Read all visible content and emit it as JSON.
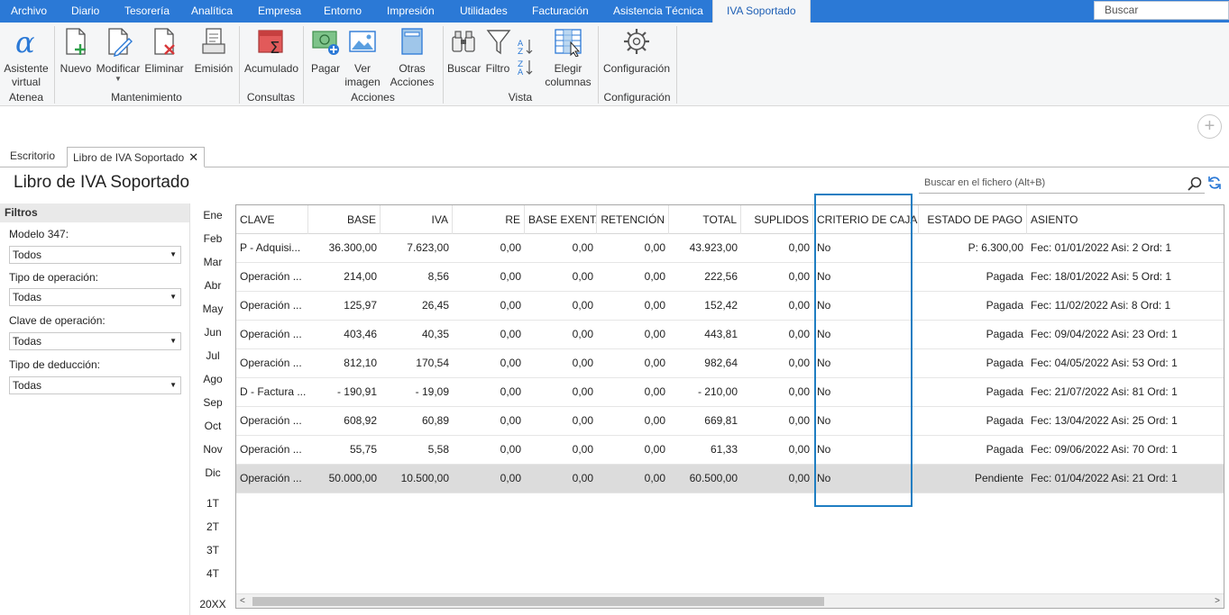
{
  "menu": {
    "items": [
      "Archivo",
      "Diario",
      "Tesorería",
      "Analítica",
      "Empresa",
      "Entorno",
      "Impresión",
      "Utilidades",
      "Facturación",
      "Asistencia Técnica",
      "IVA Soportado"
    ],
    "search_placeholder": "Buscar"
  },
  "ribbon": {
    "asistente": "Asistente virtual",
    "nuevo": "Nuevo",
    "modificar": "Modificar",
    "eliminar": "Eliminar",
    "emision": "Emisión",
    "acumulado": "Acumulado",
    "pagar": "Pagar",
    "ver_imagen": "Ver imagen",
    "otras_acciones": "Otras Acciones",
    "buscar": "Buscar",
    "filtro": "Filtro",
    "elegir_columnas": "Elegir columnas",
    "configuracion": "Configuración",
    "groups": {
      "atenea": "Atenea",
      "mantenimiento": "Mantenimiento",
      "consultas": "Consultas",
      "acciones": "Acciones",
      "vista": "Vista",
      "configuracion": "Configuración"
    }
  },
  "tabs": [
    "Escritorio",
    "Libro de IVA Soportado"
  ],
  "page_title": "Libro de IVA Soportado",
  "file_search_placeholder": "Buscar en el fichero (Alt+B)",
  "filters": {
    "title": "Filtros",
    "modelo_label": "Modelo 347:",
    "modelo_value": "Todos",
    "tipo_op_label": "Tipo de operación:",
    "tipo_op_value": "Todas",
    "clave_label": "Clave de operación:",
    "clave_value": "Todas",
    "deduccion_label": "Tipo de deducción:",
    "deduccion_value": "Todas"
  },
  "periods": {
    "months": [
      "Ene",
      "Feb",
      "Mar",
      "Abr",
      "May",
      "Jun",
      "Jul",
      "Ago",
      "Sep",
      "Oct",
      "Nov",
      "Dic"
    ],
    "quarters": [
      "1T",
      "2T",
      "3T",
      "4T"
    ],
    "year": "20XX"
  },
  "table": {
    "headers": [
      "CLAVE",
      "BASE",
      "IVA",
      "RE",
      "BASE EXENTA",
      "RETENCIÓN",
      "TOTAL",
      "SUPLIDOS",
      "CRITERIO DE CAJA",
      "ESTADO DE PAGO",
      "ASIENTO"
    ],
    "rows": [
      [
        "P - Adquisi...",
        "36.300,00",
        "7.623,00",
        "0,00",
        "0,00",
        "0,00",
        "43.923,00",
        "0,00",
        "No",
        "P: 6.300,00",
        "Fec: 01/01/2022 Asi: 2 Ord: 1"
      ],
      [
        "Operación ...",
        "214,00",
        "8,56",
        "0,00",
        "0,00",
        "0,00",
        "222,56",
        "0,00",
        "No",
        "Pagada",
        "Fec: 18/01/2022 Asi: 5 Ord: 1"
      ],
      [
        "Operación ...",
        "125,97",
        "26,45",
        "0,00",
        "0,00",
        "0,00",
        "152,42",
        "0,00",
        "No",
        "Pagada",
        "Fec: 11/02/2022 Asi: 8 Ord: 1"
      ],
      [
        "Operación ...",
        "403,46",
        "40,35",
        "0,00",
        "0,00",
        "0,00",
        "443,81",
        "0,00",
        "No",
        "Pagada",
        "Fec: 09/04/2022 Asi: 23 Ord: 1"
      ],
      [
        "Operación ...",
        "812,10",
        "170,54",
        "0,00",
        "0,00",
        "0,00",
        "982,64",
        "0,00",
        "No",
        "Pagada",
        "Fec: 04/05/2022 Asi: 53 Ord: 1"
      ],
      [
        "D - Factura ...",
        "- 190,91",
        "- 19,09",
        "0,00",
        "0,00",
        "0,00",
        "- 210,00",
        "0,00",
        "No",
        "Pagada",
        "Fec: 21/07/2022 Asi: 81 Ord: 1"
      ],
      [
        "Operación ...",
        "608,92",
        "60,89",
        "0,00",
        "0,00",
        "0,00",
        "669,81",
        "0,00",
        "No",
        "Pagada",
        "Fec: 13/04/2022 Asi: 25 Ord: 1"
      ],
      [
        "Operación ...",
        "55,75",
        "5,58",
        "0,00",
        "0,00",
        "0,00",
        "61,33",
        "0,00",
        "No",
        "Pagada",
        "Fec: 09/06/2022 Asi: 70 Ord: 1"
      ],
      [
        "Operación ...",
        "50.000,00",
        "10.500,00",
        "0,00",
        "0,00",
        "0,00",
        "60.500,00",
        "0,00",
        "No",
        "Pendiente",
        "Fec: 01/04/2022 Asi: 21 Ord: 1"
      ]
    ]
  },
  "colors": {
    "menu_bg": "#2b79d6",
    "highlight": "#1f7ec2",
    "selected_row": "#dcdcdc"
  }
}
